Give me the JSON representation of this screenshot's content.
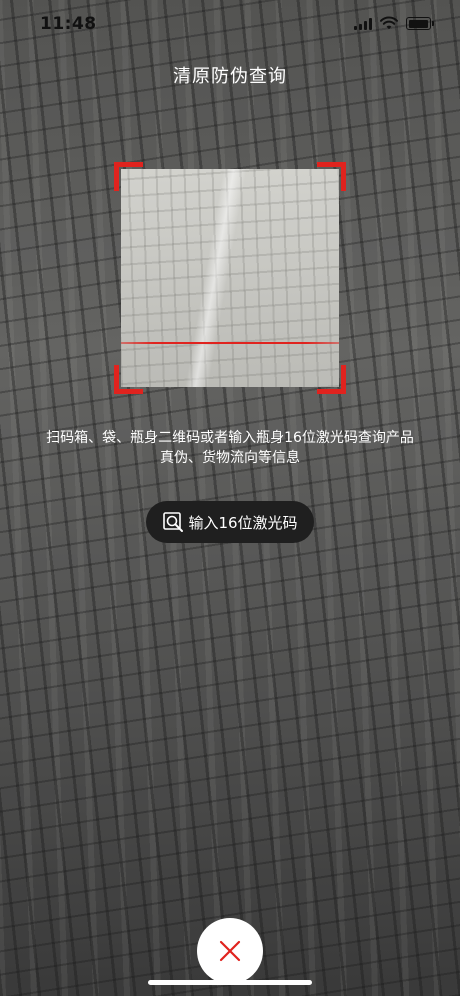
{
  "status_bar": {
    "time": "11:48",
    "icons": [
      "signal-icon",
      "wifi-icon",
      "battery-icon"
    ]
  },
  "header": {
    "title": "清原防伪查询"
  },
  "scanner": {
    "accent_color": "#e0231e"
  },
  "instructions": {
    "line1": "扫码箱、袋、瓶身二维码或者输入瓶身16位激光码查询产品",
    "line2": "真伪、货物流向等信息"
  },
  "manual_entry": {
    "label": "输入16位激光码",
    "icon": "search-icon"
  },
  "close": {
    "icon": "close-icon"
  }
}
